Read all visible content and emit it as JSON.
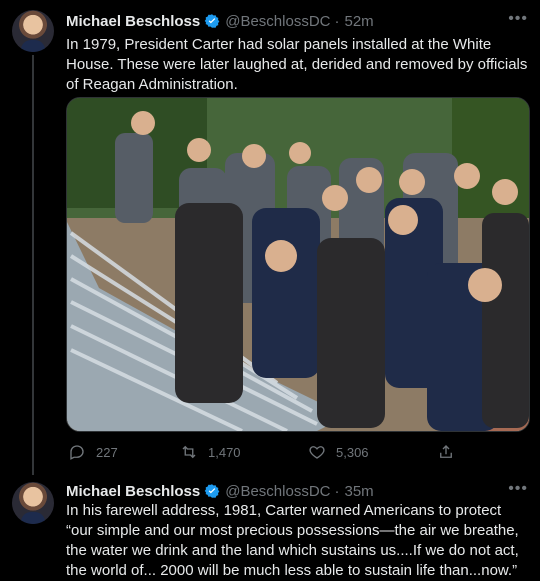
{
  "tweets": [
    {
      "author": "Michael Beschloss",
      "handle": "@BeschlossDC",
      "separator": "·",
      "time": "52m",
      "text": "In 1979, President Carter had solar panels installed at the White House. These were later laughed at, derided and removed by officials of Reagan Administration.",
      "actions": {
        "replies": "227",
        "retweets": "1,470",
        "likes": "5,306"
      }
    },
    {
      "author": "Michael Beschloss",
      "handle": "@BeschlossDC",
      "separator": "·",
      "time": "35m",
      "text": "In his farewell address, 1981, Carter warned Americans to protect “our simple and our most precious possessions—the air we breathe, the water we drink and the land which sustains us....If we do not act, the world of... 2000 will be much less able to sustain life than...now.”"
    }
  ],
  "icons": {
    "more": "more-icon",
    "verified": "verified-badge-icon",
    "reply": "reply-icon",
    "retweet": "retweet-icon",
    "like": "like-icon",
    "share": "share-icon"
  },
  "colors": {
    "background": "#000000",
    "text": "#e7e9ea",
    "secondary": "#71767b",
    "verified": "#1d9bf0"
  }
}
